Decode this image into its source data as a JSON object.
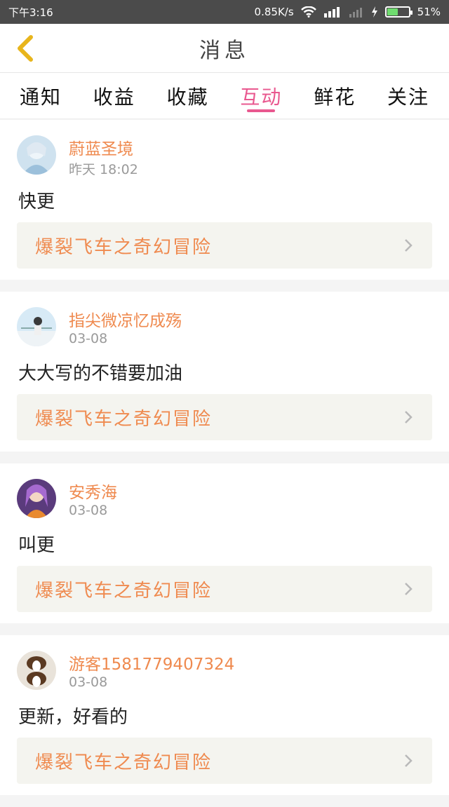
{
  "statusbar": {
    "time": "下午3:16",
    "network_speed": "0.85K/s",
    "battery_percent_text": "51%",
    "battery_level": 0.51
  },
  "header": {
    "title": "消息"
  },
  "tabs": [
    {
      "label": "通知",
      "active": false
    },
    {
      "label": "收益",
      "active": false
    },
    {
      "label": "收藏",
      "active": false
    },
    {
      "label": "互动",
      "active": true
    },
    {
      "label": "鲜花",
      "active": false
    },
    {
      "label": "关注",
      "active": false
    }
  ],
  "messages": [
    {
      "user": "蔚蓝圣境",
      "time": "昨天 18:02",
      "text": "快更",
      "book": "爆裂飞车之奇幻冒险",
      "avatar_color": "#bcd7ea"
    },
    {
      "user": "指尖微凉忆成殇",
      "time": "03-08",
      "text": "大大写的不错要加油",
      "book": "爆裂飞车之奇幻冒险",
      "avatar_color": "#cfe6f5"
    },
    {
      "user": "安秀海",
      "time": "03-08",
      "text": "叫更",
      "book": "爆裂飞车之奇幻冒险",
      "avatar_color": "#8b5bb0"
    },
    {
      "user": "游客1581779407324",
      "time": "03-08",
      "text": "更新，好看的",
      "book": "爆裂飞车之奇幻冒险",
      "avatar_color": "#6e5a44"
    }
  ],
  "colors": {
    "accent": "#e9588f",
    "orange": "#ef8a4f",
    "back_yellow": "#f0b81e"
  }
}
